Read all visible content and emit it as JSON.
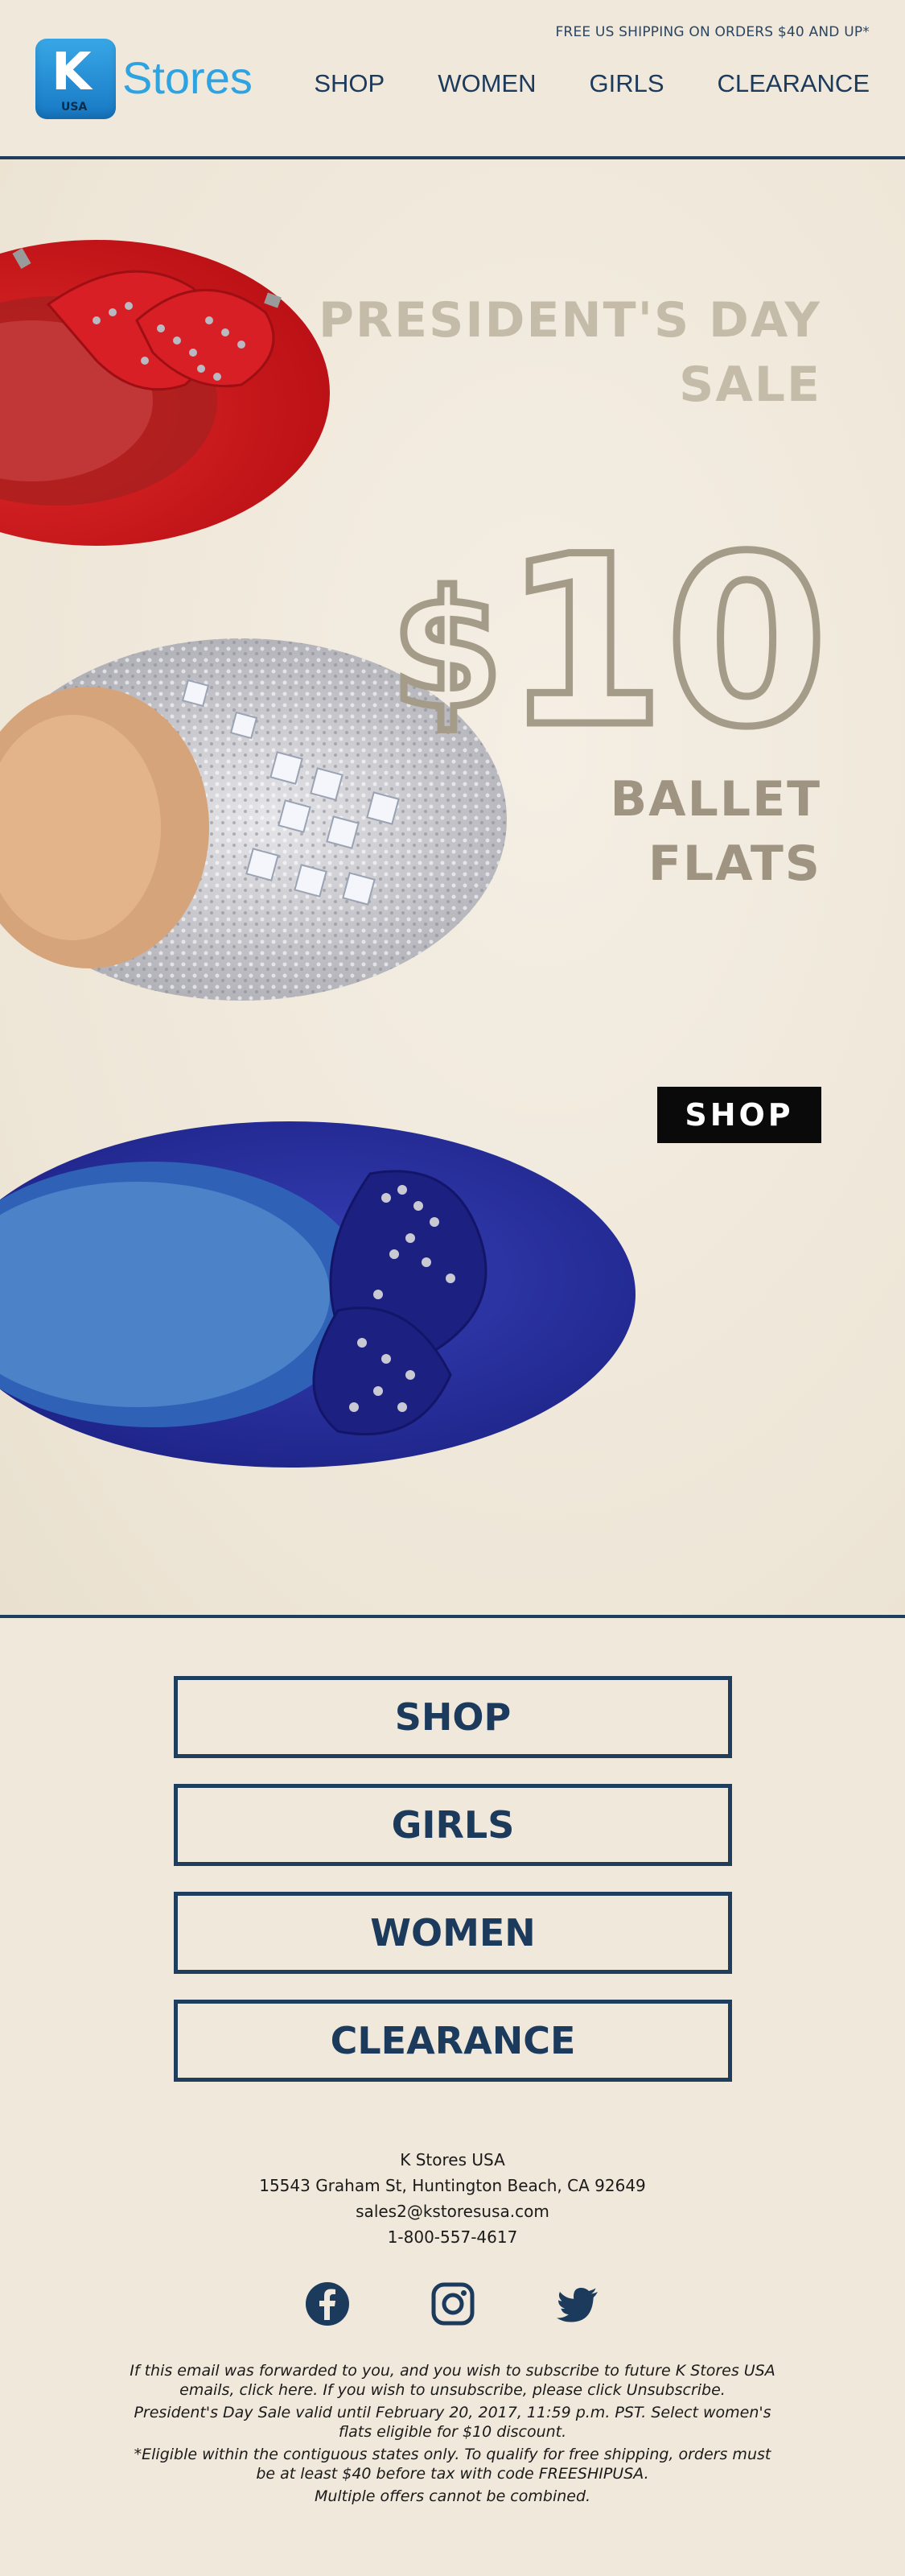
{
  "header": {
    "promo": "FREE US SHIPPING ON ORDERS $40 AND UP*",
    "logo_letter": "K",
    "logo_sub": "USA",
    "logo_name": "Stores",
    "nav": [
      "SHOP",
      "WOMEN",
      "GIRLS",
      "CLEARANCE"
    ]
  },
  "hero": {
    "headline_line1": "PRESIDENT'S DAY",
    "headline_line2": "SALE",
    "price_symbol": "$",
    "price_amount": "10",
    "subline_line1": "BALLET",
    "subline_line2": "FLATS",
    "cta": "SHOP",
    "shoes": [
      "red suede bow flat",
      "silver jeweled flat",
      "blue suede bow flat"
    ]
  },
  "buttons": [
    "SHOP",
    "GIRLS",
    "WOMEN",
    "CLEARANCE"
  ],
  "footer": {
    "company": "K Stores USA",
    "address": "15543 Graham St, Huntington Beach, CA 92649",
    "email": "sales2@kstoresusa.com",
    "phone": "1-800-557-4617",
    "social_icons": [
      "facebook-icon",
      "instagram-icon",
      "twitter-icon"
    ],
    "disclaimer_1": "If this email was forwarded to you, and you wish to subscribe to future K Stores USA emails, click here. If you wish to unsubscribe, please click Unsubscribe.",
    "disclaimer_2": "President's Day Sale valid until February 20, 2017, 11:59 p.m. PST. Select women's flats eligible for $10 discount.",
    "disclaimer_3": "*Eligible within the contiguous states only. To qualify for free shipping, orders must be at least $40 before tax with code FREESHIPUSA.",
    "disclaimer_4": "Multiple offers cannot be combined."
  },
  "colors": {
    "accent_navy": "#1f3d5c",
    "logo_blue": "#2ea3e2",
    "background": "#f0e8db",
    "cta_black": "#0a0a0a"
  }
}
